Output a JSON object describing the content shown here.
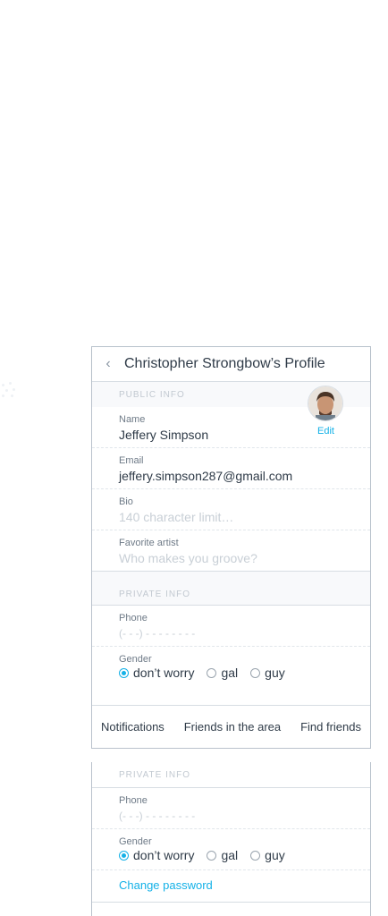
{
  "header": {
    "back_icon": "chevron-left-icon",
    "title": "Christopher Strongbow’s Profile"
  },
  "public_info": {
    "section_label": "PUBLIC INFO",
    "avatar_icon": "user-avatar",
    "edit_label": "Edit",
    "name": {
      "label": "Name",
      "value": "Jeffery Simpson"
    },
    "email": {
      "label": "Email",
      "value": "jeffery.simpson287@gmail.com"
    },
    "bio": {
      "label": "Bio",
      "placeholder": "140 character limit…"
    },
    "artist": {
      "label": "Favorite artist",
      "placeholder": "Who makes you groove?"
    }
  },
  "private_info": {
    "section_label": "PRIVATE INFO",
    "phone": {
      "label": "Phone",
      "placeholder": "(- - -) - - -  -  - - - -"
    },
    "gender": {
      "label": "Gender",
      "options": [
        "don’t worry",
        "gal",
        "guy"
      ],
      "selected": "don’t worry"
    }
  },
  "tabs": [
    "Notifications",
    "Friends in the area",
    "Find friends"
  ],
  "panel2": {
    "section_label": "PRIVATE INFO",
    "phone": {
      "label": "Phone",
      "placeholder": "(- - -) - - -  -  - - - -"
    },
    "gender": {
      "label": "Gender",
      "options": [
        "don’t worry",
        "gal",
        "guy"
      ],
      "selected": "don’t worry"
    },
    "change_password": "Change password"
  },
  "colors": {
    "accent": "#14b1e7",
    "border": "#b9c2cc",
    "text": "#2f3b48"
  }
}
